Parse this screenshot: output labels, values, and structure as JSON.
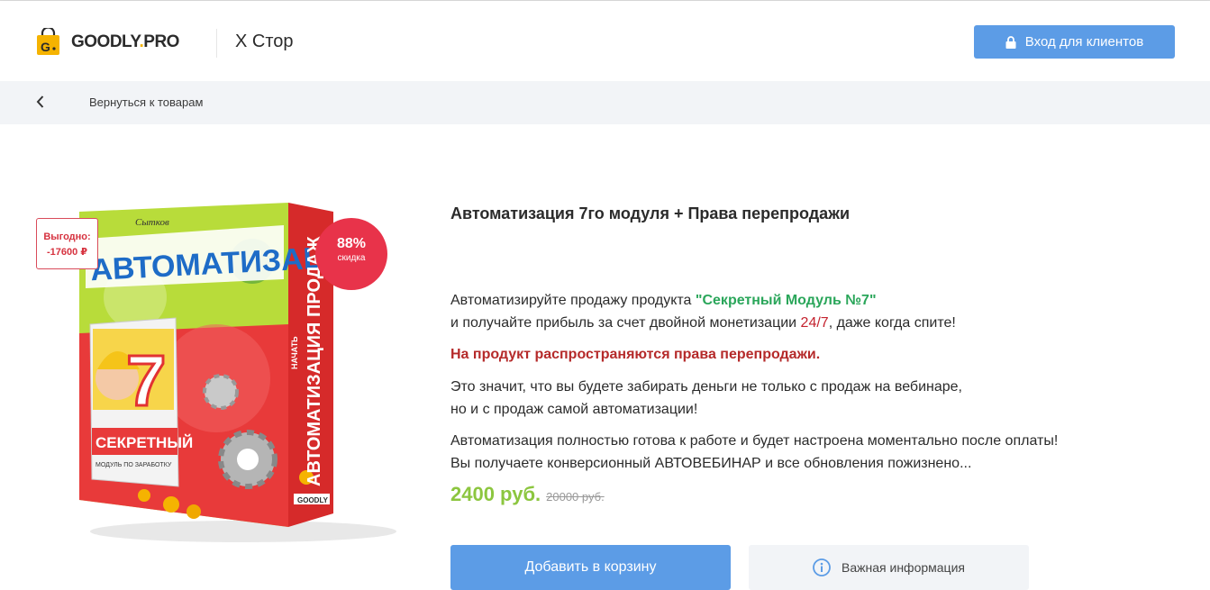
{
  "header": {
    "logo": {
      "text_main": "GOODLY",
      "text_dot": ".",
      "text_suffix": "PRO"
    },
    "store_name": "X Стор",
    "login_button": "Вход для клиентов"
  },
  "subnav": {
    "back_link": "Вернуться к товарам"
  },
  "product": {
    "badge_benefit_line1": "Выгодно:",
    "badge_benefit_line2": "-17600 ₽",
    "badge_discount_pct": "88%",
    "badge_discount_label": "скидка",
    "image_text": {
      "box_title": "АВТОМАТИЗАЦИЯ",
      "box_side": "АВТОМАТИЗАЦИЯ ПРОДАЖ",
      "box_side_small": "НАЧАТЬ",
      "book_title": "СЕКРЕТНЫЙ",
      "book_sub": "МОДУЛЬ ПО ЗАРАБОТКУ",
      "book_number": "7",
      "brand": "GOODLY",
      "author": "Сытков"
    },
    "title": "Автоматизация 7го модуля + Права перепродажи",
    "desc1_prefix": "Автоматизируйте продажу продукта ",
    "desc1_highlight": "\"Секретный Модуль №7\"",
    "desc2_prefix": "и получайте прибыль за счет двойной монетизации ",
    "desc2_highlight": "24/7",
    "desc2_suffix": ", даже когда спите!",
    "rights_text": "На продукт распространяются права перепродажи.",
    "desc3_line1": "Это значит, что вы будете забирать деньги не только с продаж на вебинаре,",
    "desc3_line2": "но и с продаж самой автоматизации!",
    "desc4_line1": "Автоматизация полностью готова к работе и будет настроена моментально после оплаты!",
    "desc4_line2": "Вы получаете конверсионный АВТОВЕБИНАР и все обновления пожизнено...",
    "price_new": "2400 руб.",
    "price_old": "20000 руб.",
    "cart_button": "Добавить в корзину",
    "info_button": "Важная информация"
  },
  "colors": {
    "accent_blue": "#5c9ce6",
    "price_green": "#8cc63f",
    "highlight_green": "#2aa65a",
    "discount_red": "#e8334a"
  },
  "icons": [
    "logo-bag-icon",
    "lock-icon",
    "chevron-left-icon",
    "info-icon"
  ]
}
